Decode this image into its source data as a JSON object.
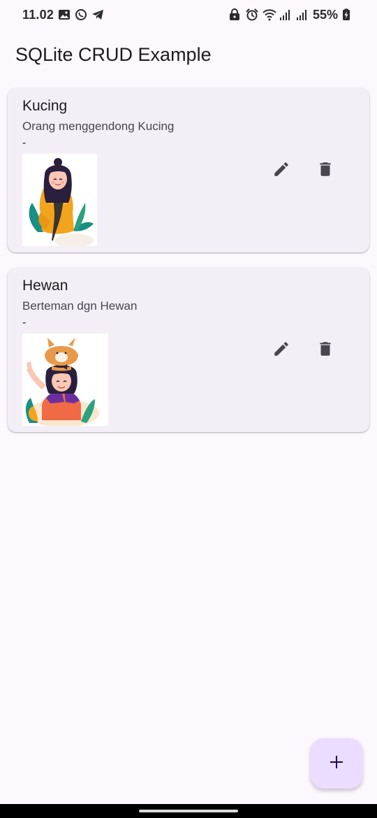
{
  "status_bar": {
    "time": "11.02",
    "battery": "55%",
    "left_icons": [
      "gallery-icon",
      "whatsapp-icon",
      "telegram-icon"
    ],
    "right_icons": [
      "lock-icon",
      "alarm-icon",
      "wifi-icon",
      "signal-icon",
      "signal-icon",
      "battery-charging-icon"
    ]
  },
  "app_bar": {
    "title": "SQLite CRUD Example"
  },
  "items": [
    {
      "title": "Kucing",
      "description": "Orang menggendong Kucing",
      "extra": "-",
      "image": "woman-holding-cat-illustration"
    },
    {
      "title": "Hewan",
      "description": "Berteman dgn Hewan",
      "extra": "-",
      "image": "girl-with-cat-on-head-illustration"
    }
  ],
  "actions": {
    "edit_icon": "edit-icon",
    "delete_icon": "delete-icon"
  },
  "fab": {
    "icon": "plus-icon"
  },
  "colors": {
    "background": "#fdf7fe",
    "card": "#f4eff6",
    "fab": "#eaddff",
    "icon": "#49454f",
    "text": "#1d1b20"
  }
}
